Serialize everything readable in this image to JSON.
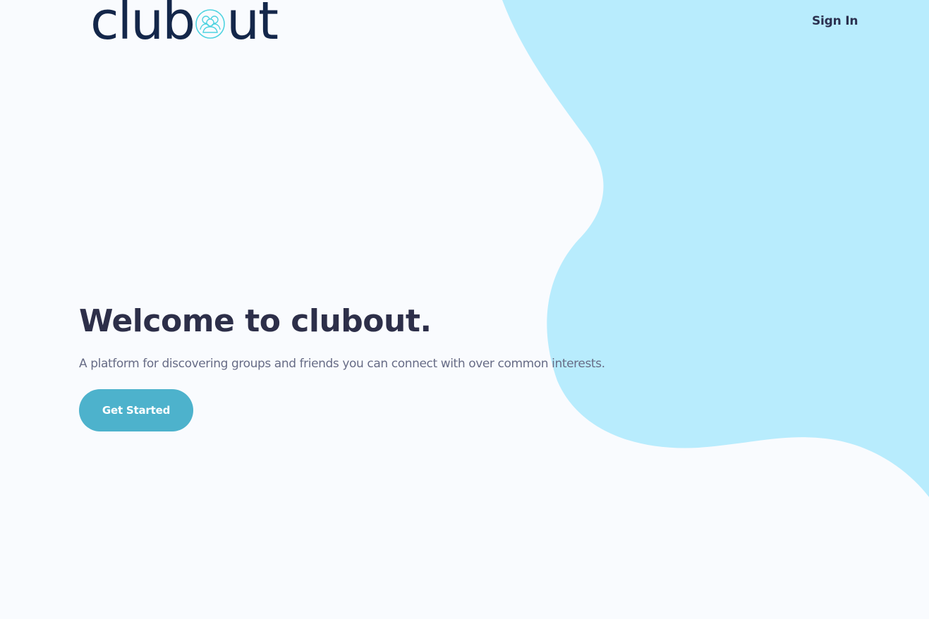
{
  "brand": {
    "name_prefix": "club",
    "name_suffix": "ut",
    "logo_icon": "people-circle-icon",
    "text_color": "#14274a",
    "icon_color": "#4fd3e0"
  },
  "nav": {
    "signin_label": "Sign In"
  },
  "hero": {
    "title": "Welcome to clubout.",
    "subtitle": "A platform for discovering groups and friends you can connect with over common interests.",
    "cta_label": "Get Started"
  },
  "colors": {
    "background": "#f9fbfe",
    "blob": "#b8ecfd",
    "cta": "#4db2cc",
    "heading": "#2d2f49",
    "subtitle": "#676c86"
  }
}
